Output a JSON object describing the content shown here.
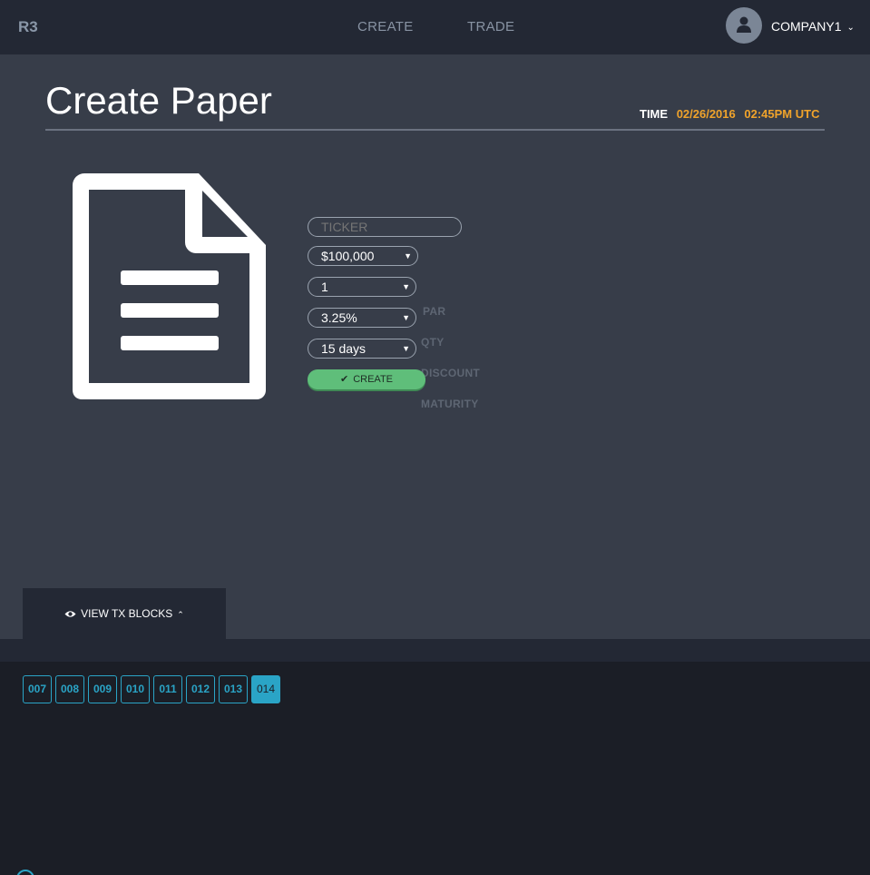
{
  "topbar": {
    "brand": "R3",
    "nav": [
      {
        "label": "CREATE"
      },
      {
        "label": "TRADE"
      }
    ],
    "company": "COMPANY1",
    "company_icon": "user-icon"
  },
  "page": {
    "title": "Create Paper",
    "time_label": "TIME",
    "date": "02/26/2016",
    "time": "02:45PM UTC"
  },
  "form": {
    "ticker_placeholder": "TICKER",
    "par": {
      "value": "$100,000",
      "label": "PAR"
    },
    "qty": {
      "value": "1",
      "label": "QTY"
    },
    "discount": {
      "value": "3.25%",
      "label": "DISCOUNT"
    },
    "maturity": {
      "value": "15 days",
      "label": "MATURITY"
    },
    "create_label": "CREATE"
  },
  "tx": {
    "toggle_label": "VIEW TX BLOCKS",
    "blocks": [
      "007",
      "008",
      "009",
      "010",
      "011",
      "012",
      "013",
      "014"
    ],
    "active_block": "014"
  },
  "colors": {
    "accent": "#f0a32b",
    "success": "#5fbe7a",
    "block": "#2aa4c6"
  }
}
